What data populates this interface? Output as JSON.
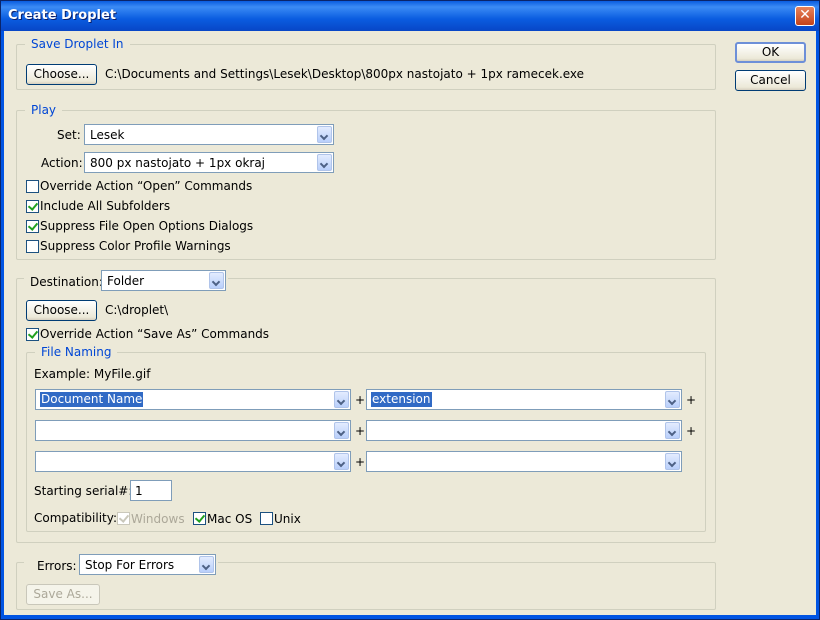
{
  "window": {
    "title": "Create Droplet",
    "close_glyph": "✕"
  },
  "buttons": {
    "ok": "OK",
    "cancel": "Cancel"
  },
  "save_droplet": {
    "legend": "Save Droplet In",
    "choose": "Choose...",
    "path": "C:\\Documents and Settings\\Lesek\\Desktop\\800px nastojato + 1px ramecek.exe"
  },
  "play": {
    "legend": "Play",
    "set_label": "Set:",
    "set_value": "Lesek",
    "action_label": "Action:",
    "action_value": "800 px nastojato + 1px okraj",
    "options": [
      {
        "label": "Override Action “Open” Commands",
        "checked": false
      },
      {
        "label": "Include All Subfolders",
        "checked": true
      },
      {
        "label": "Suppress File Open Options Dialogs",
        "checked": true
      },
      {
        "label": "Suppress Color Profile Warnings",
        "checked": false
      }
    ]
  },
  "destination": {
    "label": "Destination:",
    "value": "Folder",
    "choose": "Choose...",
    "path": "C:\\droplet\\",
    "override_label": "Override Action “Save As” Commands",
    "override_checked": true
  },
  "file_naming": {
    "legend": "File Naming",
    "example": "Example: MyFile.gif",
    "fields": [
      "Document Name",
      "extension",
      "",
      "",
      "",
      ""
    ],
    "plus": "+",
    "serial_label": "Starting serial#:",
    "serial_value": "1",
    "compat_label": "Compatibility:",
    "compat": [
      {
        "label": "Windows",
        "checked": true,
        "disabled": true
      },
      {
        "label": "Mac OS",
        "checked": true,
        "disabled": false
      },
      {
        "label": "Unix",
        "checked": false,
        "disabled": false
      }
    ]
  },
  "errors": {
    "label": "Errors:",
    "value": "Stop For Errors",
    "save_as": "Save As..."
  },
  "colors": {
    "title_bar": "#0a5ce0",
    "dialog_bg": "#ece9d8",
    "legend_text": "#0046d5",
    "selection": "#316ac5"
  },
  "icons": {
    "close": "close-icon",
    "dropdown": "chevron-down-icon",
    "check": "checkmark-icon"
  }
}
